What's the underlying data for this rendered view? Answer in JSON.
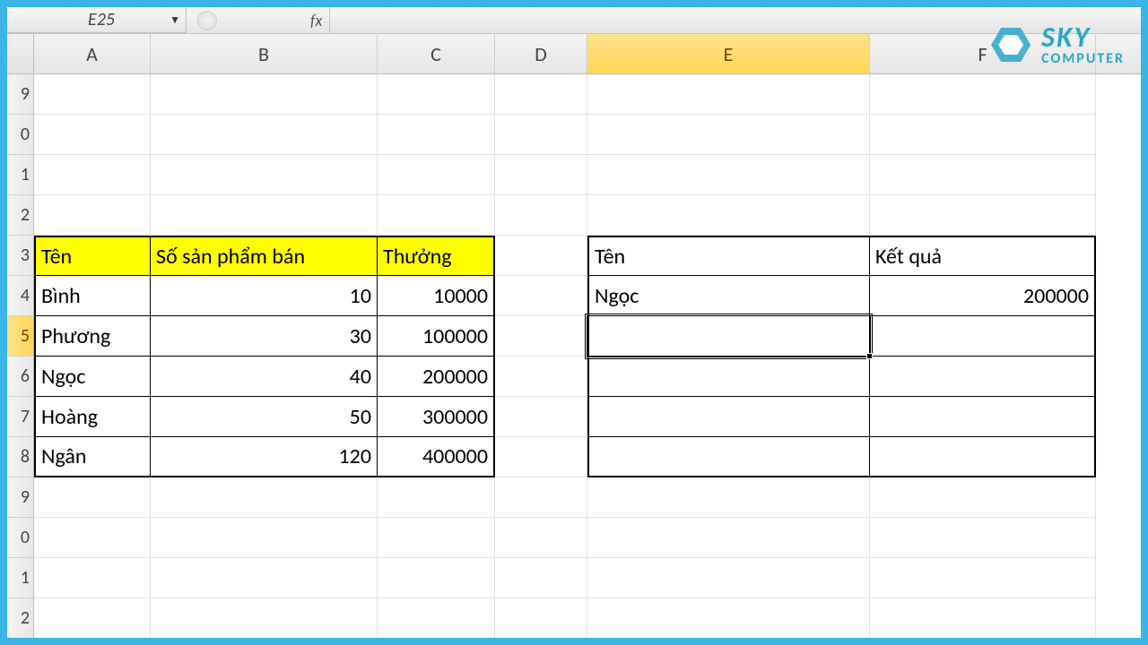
{
  "namebox_ref": "E25",
  "fx_label": "fx",
  "columns": [
    "A",
    "B",
    "C",
    "D",
    "E",
    "F"
  ],
  "visible_rows": [
    "9",
    "0",
    "1",
    "2",
    "3",
    "4",
    "5",
    "6",
    "7",
    "8",
    "9",
    "0",
    "1",
    "2"
  ],
  "active_row_label": "5",
  "active_row_index": 6,
  "active_col": "E",
  "table1": {
    "header": [
      "Tên",
      "Số sản phẩm bán",
      "Thưởng"
    ],
    "rows": [
      {
        "ten": "Bình",
        "so": "10",
        "thuong": "10000"
      },
      {
        "ten": "Phương",
        "so": "30",
        "thuong": "100000"
      },
      {
        "ten": "Ngọc",
        "so": "40",
        "thuong": "200000"
      },
      {
        "ten": "Hoàng",
        "so": "50",
        "thuong": "300000"
      },
      {
        "ten": "Ngân",
        "so": "120",
        "thuong": "400000"
      }
    ]
  },
  "table2": {
    "header": [
      "Tên",
      "Kết quả"
    ],
    "rows": [
      {
        "ten": "Ngọc",
        "kq": "200000"
      },
      {
        "ten": "",
        "kq": ""
      },
      {
        "ten": "",
        "kq": ""
      },
      {
        "ten": "",
        "kq": ""
      },
      {
        "ten": "",
        "kq": ""
      }
    ]
  },
  "logo": {
    "line1": "SKY",
    "line2": "COMPUTER"
  },
  "chart_data": {
    "type": "table",
    "tables": [
      {
        "columns": [
          "Tên",
          "Số sản phẩm bán",
          "Thưởng"
        ],
        "rows": [
          [
            "Bình",
            10,
            10000
          ],
          [
            "Phương",
            30,
            100000
          ],
          [
            "Ngọc",
            40,
            200000
          ],
          [
            "Hoàng",
            50,
            300000
          ],
          [
            "Ngân",
            120,
            400000
          ]
        ]
      },
      {
        "columns": [
          "Tên",
          "Kết quả"
        ],
        "rows": [
          [
            "Ngọc",
            200000
          ]
        ]
      }
    ]
  }
}
